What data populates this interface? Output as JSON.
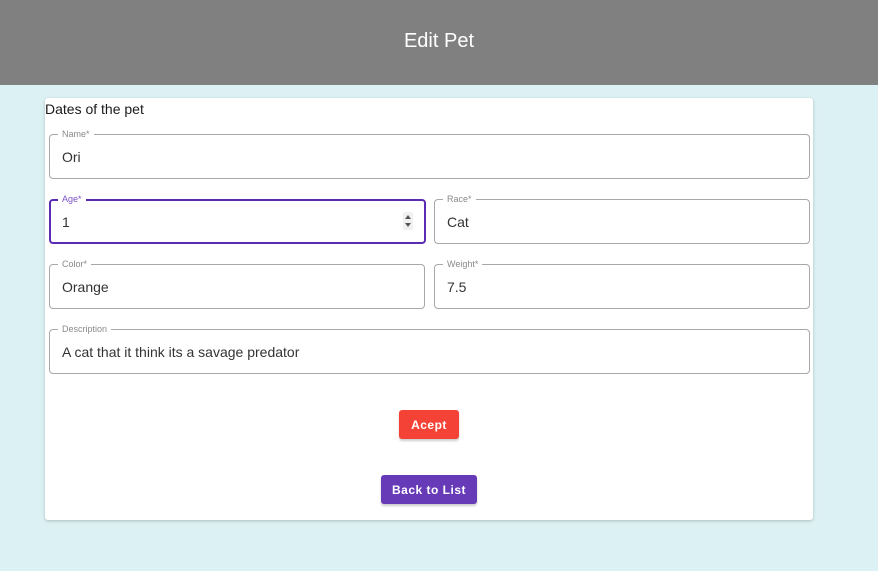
{
  "header": {
    "title": "Edit Pet"
  },
  "form": {
    "title": "Dates of the pet",
    "fields": {
      "name": {
        "label": "Name",
        "value": "Ori"
      },
      "age": {
        "label": "Age",
        "value": "1"
      },
      "race": {
        "label": "Race",
        "value": "Cat"
      },
      "color": {
        "label": "Color",
        "value": "Orange"
      },
      "weight": {
        "label": "Weight",
        "value": "7.5"
      },
      "description": {
        "label": "Description",
        "value": "A cat that it think its a savage predator"
      }
    },
    "required_marker": "*",
    "accept_label": "Acept",
    "back_label": "Back to List"
  },
  "colors": {
    "header_bg": "#808080",
    "page_bg": "#dcf1f3",
    "focus": "#5b2bb2",
    "accept_button": "#f44336",
    "back_button": "#673ab7"
  },
  "icons": {
    "age_spinner": "spinner-icon"
  }
}
